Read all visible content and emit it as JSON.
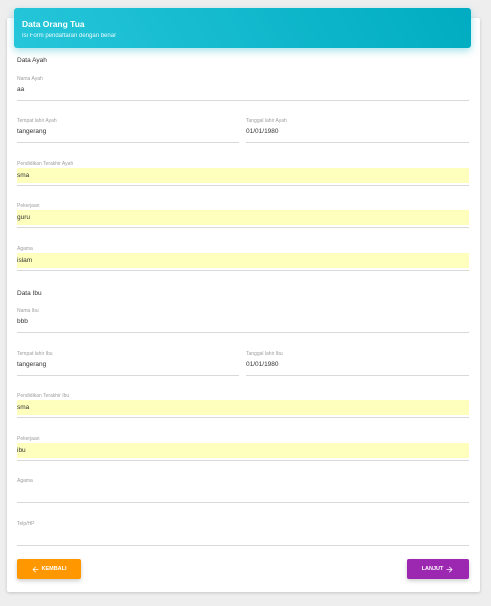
{
  "header": {
    "title": "Data Orang Tua",
    "subtitle": "Isi Form pendaftaran dengan benar"
  },
  "sections": {
    "ayah": "Data Ayah",
    "ibu": "Data Ibu"
  },
  "ayah": {
    "nama": {
      "label": "Nama Ayah",
      "value": "aa"
    },
    "tempat": {
      "label": "Tempat lahir Ayah",
      "value": "tangerang"
    },
    "tanggal": {
      "label": "Tanggal lahir Ayah",
      "value": "01/01/1980"
    },
    "pendidikan": {
      "label": "Pendidikan Terakhir Ayah",
      "value": "sma"
    },
    "pekerjaan": {
      "label": "Pekerjaan",
      "value": "guru"
    },
    "agama": {
      "label": "Agama",
      "value": "islam"
    }
  },
  "ibu": {
    "nama": {
      "label": "Nama Ibu",
      "value": "bbb"
    },
    "tempat": {
      "label": "Tempat lahir Ibu",
      "value": "tangerang"
    },
    "tanggal": {
      "label": "Tanggal lahir Ibu",
      "value": "01/01/1980"
    },
    "pendidikan": {
      "label": "Pendidikan Terakhir Ibu",
      "value": "sma"
    },
    "pekerjaan": {
      "label": "Pekerjaan",
      "value": "ibu"
    },
    "agama": {
      "label": "Agama",
      "value": ""
    }
  },
  "telp": {
    "label": "Telp/HP",
    "value": ""
  },
  "buttons": {
    "back": "KEMBALI",
    "next": "LANJUT"
  },
  "colors": {
    "header": "#00acc1",
    "back": "#ff9800",
    "next": "#9c27b0",
    "highlight": "#ffffbd"
  },
  "icons": {
    "back": "arrow-left-icon",
    "next": "arrow-right-icon"
  }
}
